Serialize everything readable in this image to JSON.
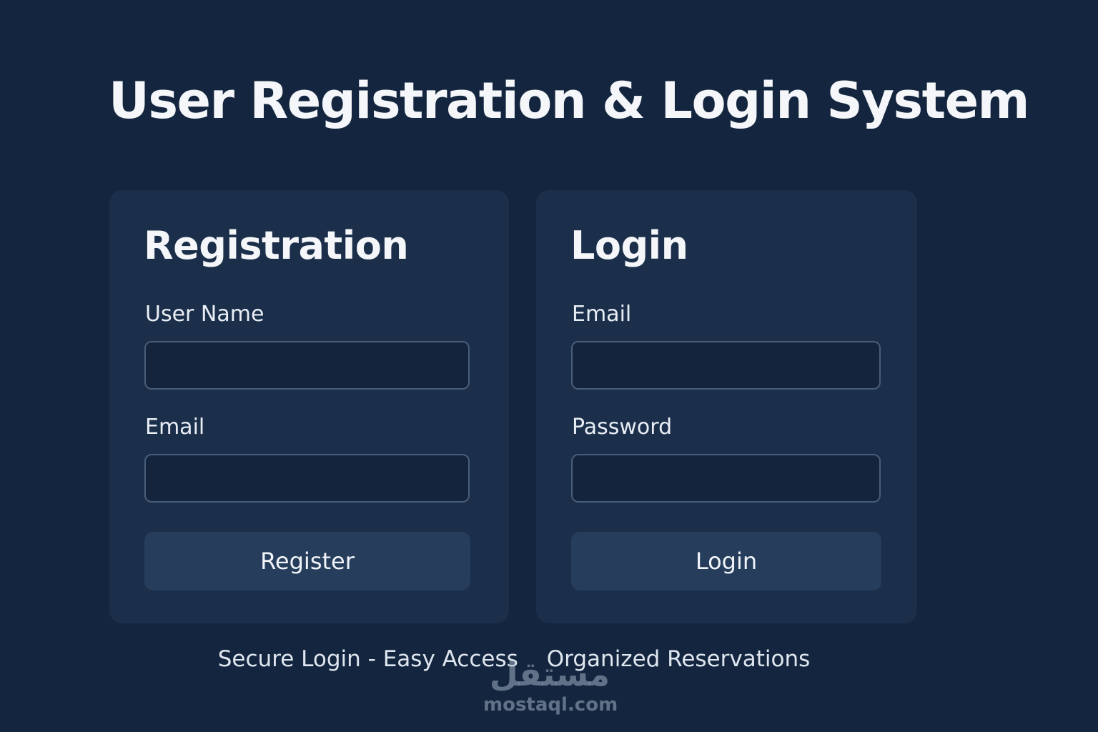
{
  "page": {
    "title": "User Registration & Login System"
  },
  "registration": {
    "title": "Registration",
    "username_label": "User Name",
    "username_value": "",
    "email_label": "Email",
    "email_value": "",
    "submit_label": "Register"
  },
  "login": {
    "title": "Login",
    "email_label": "Email",
    "email_value": "",
    "password_label": "Password",
    "password_value": "",
    "submit_label": "Login"
  },
  "footer": {
    "tagline_left": "Secure Login - Easy Access",
    "tagline_right": "Organized Reservations"
  },
  "watermark": {
    "mark": "مستقل",
    "url": "mostaql.com"
  },
  "colors": {
    "background": "#14263f",
    "card": "#1b2e4a",
    "input": "#14243d",
    "button": "#263d5c",
    "text": "#f4f6f9"
  }
}
